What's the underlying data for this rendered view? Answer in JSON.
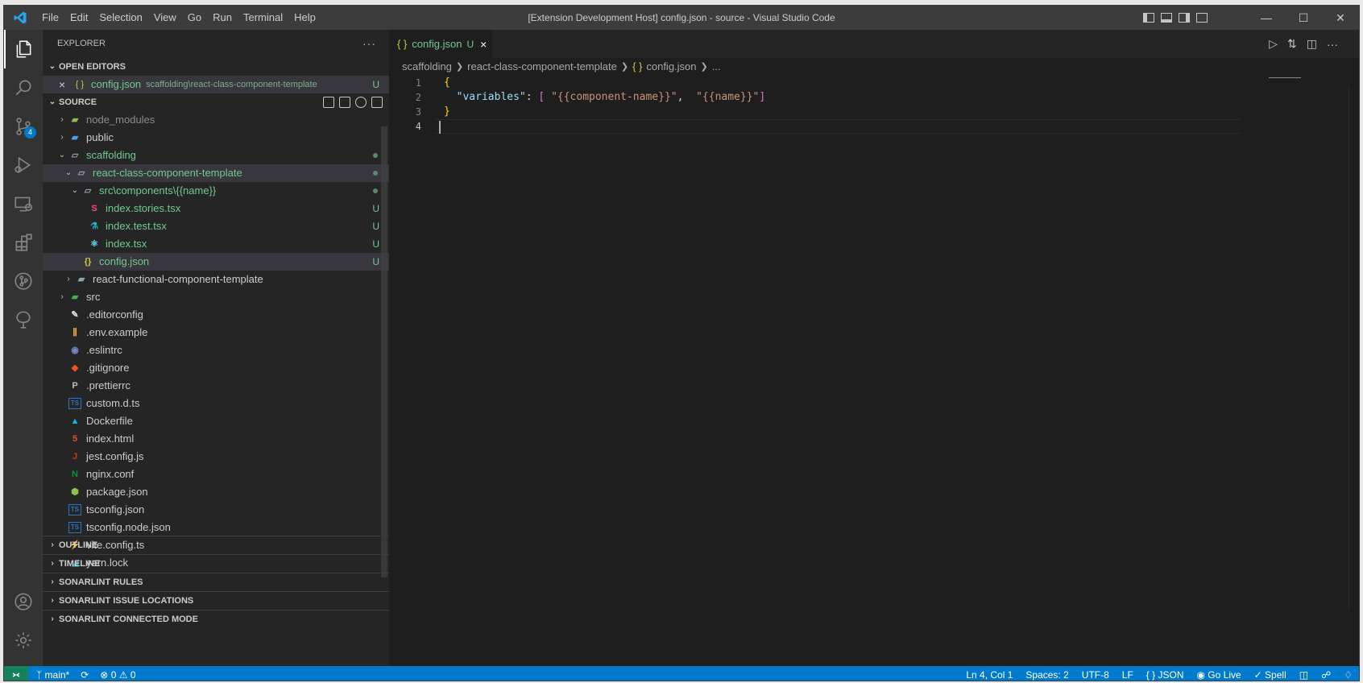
{
  "titlebar": {
    "menu": [
      "File",
      "Edit",
      "Selection",
      "View",
      "Go",
      "Run",
      "Terminal",
      "Help"
    ],
    "title": "[Extension Development Host] config.json - source - Visual Studio Code"
  },
  "activity": {
    "items": [
      "explorer-icon",
      "search-icon",
      "source-control-icon",
      "run-debug-icon",
      "remote-explorer-icon",
      "extensions-icon",
      "git-graph-icon",
      "sonarlint-icon"
    ],
    "source_control_badge": "4"
  },
  "sidebar": {
    "title": "EXPLORER",
    "more": "···",
    "open_editors": {
      "header": "OPEN EDITORS",
      "items": [
        {
          "close": "×",
          "icon": "{ }",
          "name": "config.json",
          "path": "scaffolding\\react-class-component-template",
          "status": "U"
        }
      ]
    },
    "source": {
      "header": "SOURCE",
      "tree": [
        {
          "name": "node_modules",
          "depth": 0,
          "twistie": "›",
          "icon": "folder-node-icon",
          "dim": true
        },
        {
          "name": "public",
          "depth": 0,
          "twistie": "›",
          "icon": "folder-public-icon"
        },
        {
          "name": "scaffolding",
          "depth": 0,
          "twistie": "⌄",
          "icon": "folder-open-icon",
          "green": true,
          "dot": true
        },
        {
          "name": "react-class-component-template",
          "depth": 1,
          "twistie": "⌄",
          "icon": "folder-open-icon",
          "green": true,
          "dot": true,
          "selected": true
        },
        {
          "name": "src\\components\\{{name}}",
          "depth": 2,
          "twistie": "⌄",
          "icon": "folder-open-icon",
          "green": true,
          "dot": true
        },
        {
          "name": "index.stories.tsx",
          "depth": 3,
          "icon": "storybook-icon",
          "green": true,
          "status": "U"
        },
        {
          "name": "index.test.tsx",
          "depth": 3,
          "icon": "test-flask-icon",
          "green": true,
          "status": "U"
        },
        {
          "name": "index.tsx",
          "depth": 3,
          "icon": "react-icon",
          "green": true,
          "status": "U"
        },
        {
          "name": "config.json",
          "depth": 2,
          "icon": "json-icon",
          "green": true,
          "status": "U",
          "selected": true
        },
        {
          "name": "react-functional-component-template",
          "depth": 1,
          "twistie": "›",
          "icon": "folder-icon"
        },
        {
          "name": "src",
          "depth": 0,
          "twistie": "›",
          "icon": "folder-src-icon"
        },
        {
          "name": ".editorconfig",
          "depth": 0,
          "icon": "editorconfig-icon"
        },
        {
          "name": ".env.example",
          "depth": 0,
          "icon": "env-icon"
        },
        {
          "name": ".eslintrc",
          "depth": 0,
          "icon": "eslint-icon"
        },
        {
          "name": ".gitignore",
          "depth": 0,
          "icon": "git-icon"
        },
        {
          "name": ".prettierrc",
          "depth": 0,
          "icon": "prettier-icon"
        },
        {
          "name": "custom.d.ts",
          "depth": 0,
          "icon": "typescript-def-icon"
        },
        {
          "name": "Dockerfile",
          "depth": 0,
          "icon": "docker-icon"
        },
        {
          "name": "index.html",
          "depth": 0,
          "icon": "html-icon"
        },
        {
          "name": "jest.config.js",
          "depth": 0,
          "icon": "jest-icon"
        },
        {
          "name": "nginx.conf",
          "depth": 0,
          "icon": "nginx-icon"
        },
        {
          "name": "package.json",
          "depth": 0,
          "icon": "npm-icon"
        },
        {
          "name": "tsconfig.json",
          "depth": 0,
          "icon": "tsconfig-icon"
        },
        {
          "name": "tsconfig.node.json",
          "depth": 0,
          "icon": "tsconfig-icon"
        },
        {
          "name": "vite.config.ts",
          "depth": 0,
          "icon": "vite-icon"
        },
        {
          "name": "yarn.lock",
          "depth": 0,
          "icon": "yarn-icon"
        }
      ]
    },
    "collapsed_sections": [
      "OUTLINE",
      "TIMELINE",
      "SONARLINT RULES",
      "SONARLINT ISSUE LOCATIONS",
      "SONARLINT CONNECTED MODE"
    ]
  },
  "editor": {
    "tab": {
      "icon": "{ }",
      "name": "config.json",
      "status": "U",
      "close": "×"
    },
    "breadcrumbs": [
      "scaffolding",
      "react-class-component-template",
      "config.json",
      "..."
    ],
    "breadcrumb_file_icon": "{ }",
    "lines": [
      {
        "num": "1"
      },
      {
        "num": "2"
      },
      {
        "num": "3"
      },
      {
        "num": "4"
      }
    ],
    "code": {
      "open_brace": "{",
      "key": "\"variables\"",
      "colon": ": ",
      "open_bracket": "[",
      "str1": "\"{{component-name}}\"",
      "comma": ",  ",
      "str2": "\"{{name}}\"",
      "close_bracket": "]",
      "close_brace": "}"
    }
  },
  "statusbar": {
    "branch": "main*",
    "errors": "0",
    "warnings": "0",
    "position": "Ln 4, Col 1",
    "spaces": "Spaces: 2",
    "encoding": "UTF-8",
    "eol": "LF",
    "language": "{ } JSON",
    "golive": "Go Live",
    "spell": "Spell"
  },
  "colors": {
    "accent": "#007acc",
    "untracked": "#73c991",
    "remote": "#16825d"
  }
}
